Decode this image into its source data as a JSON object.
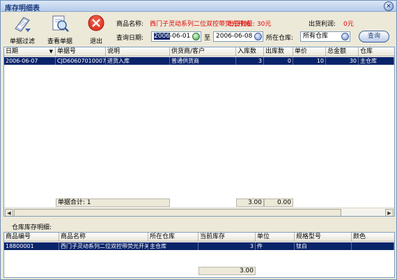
{
  "window": {
    "title": "库存明细表",
    "close_glyph": "×"
  },
  "toolbar": {
    "filter_label": "单据过滤",
    "view_label": "查看单据",
    "exit_label": "退出"
  },
  "info": {
    "product_label": "商品名称:",
    "product_value": "西门子灵动系列二位双控带荧光开关",
    "product_overlay": "出货数量: 30元",
    "profit_label": "出货利润:",
    "profit_value": "0元",
    "date_label": "查询日期:",
    "date_from_sel": "2006",
    "date_from_rest": "-06-01",
    "to_label": "至",
    "date_to": "2006-06-08",
    "warehouse_label": "所在仓库:",
    "warehouse_value": "所有仓库",
    "query_label": "查询"
  },
  "main_table": {
    "headers": [
      "日期",
      "单据号",
      "说明",
      "供货商/客户",
      "入库数",
      "出库数",
      "单价",
      "总金额",
      "仓库"
    ],
    "rows": [
      [
        "2006-06-07",
        "CJD60607010007",
        "进货入库",
        "普通供货商",
        "3",
        "0",
        "10",
        "30",
        "主仓库"
      ]
    ],
    "footer": {
      "count": "单据合计: 1",
      "in_total": "3.00",
      "out_total": "0.00"
    }
  },
  "stock_section": {
    "label": "仓库库存明细:"
  },
  "stock_table": {
    "headers": [
      "商品编号",
      "商品名称",
      "所在仓库",
      "当前库存",
      "单位",
      "规格型号",
      "颜色"
    ],
    "rows": [
      [
        "18800001",
        "西门子灵动系列二位双控带荧光开关",
        "主仓库",
        "3",
        "件",
        "钛白",
        ""
      ]
    ],
    "footer": {
      "total": "3.00"
    }
  },
  "colors": {
    "selection": "#0a246a",
    "alert": "#e00000",
    "window_bg": "#ece9d8"
  }
}
